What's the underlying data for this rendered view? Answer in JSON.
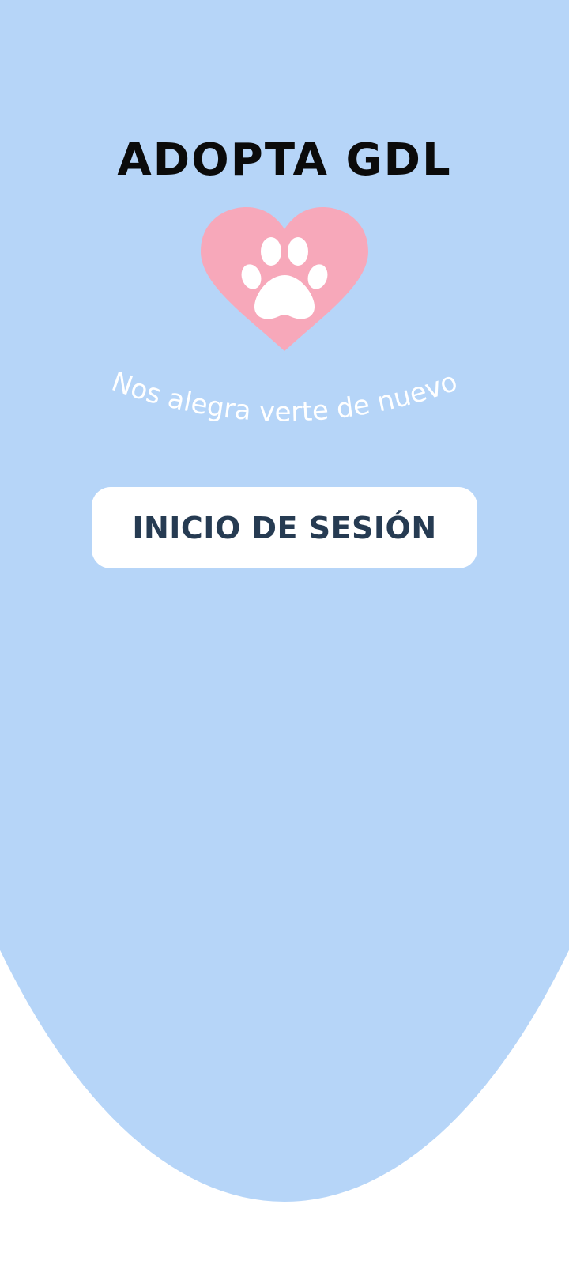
{
  "app": {
    "title": "ADOPTA GDL",
    "greeting": "¡Nos alegra verte de nuevo!",
    "logo_icon": "heart-paw-icon"
  },
  "actions": {
    "login_label": "INICIO DE SESIÓN"
  },
  "colors": {
    "background_blob": "#b6d5f8",
    "page_background": "#ffffff",
    "heart": "#f7a8ba",
    "paw": "#ffffff",
    "button_background": "#ffffff",
    "button_text": "#263b52",
    "title_text": "#0b0b0b",
    "greeting_text": "#ffffff"
  }
}
